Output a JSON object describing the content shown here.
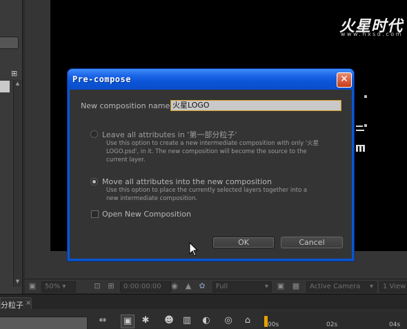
{
  "dialog": {
    "title": "Pre-compose",
    "close_glyph": "✕",
    "name_label": "New composition name:",
    "name_value": "火星LOGO",
    "options": [
      {
        "label": "Leave all attributes in '第一部分粒子'",
        "description": "Use this option to create a new intermediate composition with only '火星 LOGO.psd', in it. The new composition will become the source to the current layer.",
        "selected": false,
        "enabled": false
      },
      {
        "label": "Move all attributes into the new composition",
        "description": "Use this option to place the currently selected layers together into a new intermediate composition.",
        "selected": true,
        "enabled": true
      }
    ],
    "open_new_label": "Open New Composition",
    "open_new_checked": false,
    "ok_label": "OK",
    "cancel_label": "Cancel"
  },
  "watermark": {
    "brand": "火星时代",
    "url": "www.hxsd.com"
  },
  "viewer": {
    "zoom": "50%",
    "timecode": "0:00:00:00",
    "resolution": "Full",
    "camera": "Active Camera",
    "views": "1 View"
  },
  "timeline": {
    "tab_label": "分粒子",
    "tab_close": "×",
    "ruler_marks": [
      "00s",
      "02s",
      "04s"
    ]
  },
  "icons": [
    "tree-icon",
    "snapshot-icon",
    "color-channel-icon",
    "region-icon",
    "grid-icon",
    "transparency-grid-icon",
    "composition-flowchart-icon",
    "draft-3d-icon",
    "motion-blur-icon",
    "frame-blending-icon",
    "graph-editor-icon",
    "shy-layers-icon"
  ],
  "colors": {
    "title_bar": "#1b63e6",
    "dialog_body": "#343434",
    "input_focus_border": "#d39a1d",
    "playhead": "#e9a200",
    "close_button": "#c93b18"
  }
}
